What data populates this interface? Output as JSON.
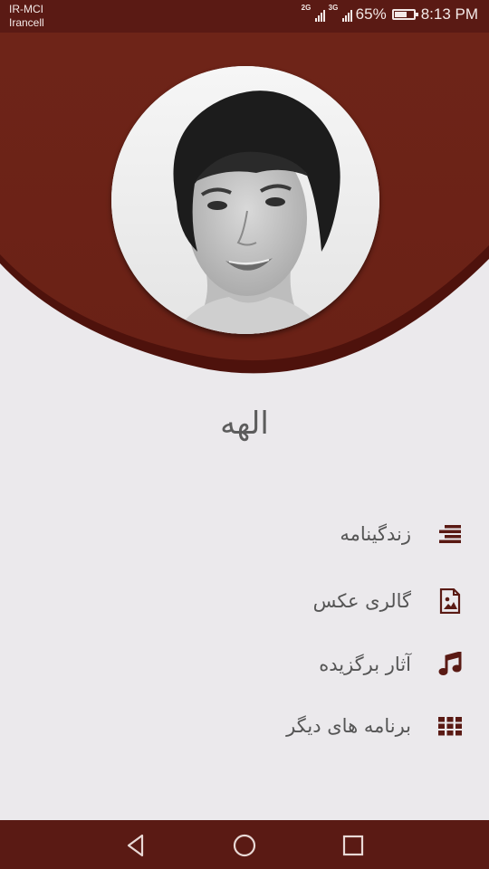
{
  "status_bar": {
    "carrier_1": "IR-MCI",
    "carrier_2": "Irancell",
    "network_1": "2G",
    "network_2": "3G",
    "battery": "65%",
    "battery_level": 0.65,
    "time": "8:13 PM"
  },
  "colors": {
    "primary": "#6b2317",
    "primary_dark": "#5a1a14",
    "background": "#ebe9ec",
    "text": "#555555"
  },
  "profile": {
    "name": "الهه"
  },
  "menu": {
    "items": [
      {
        "label": "زندگینامه",
        "icon": "list-icon"
      },
      {
        "label": "گالری عکس",
        "icon": "image-icon"
      },
      {
        "label": "آثار برگزیده",
        "icon": "music-note-icon"
      },
      {
        "label": "برنامه های دیگر",
        "icon": "grid-icon"
      }
    ]
  },
  "nav_bar": {
    "back": "back-icon",
    "home": "home-icon",
    "recents": "recents-icon"
  }
}
